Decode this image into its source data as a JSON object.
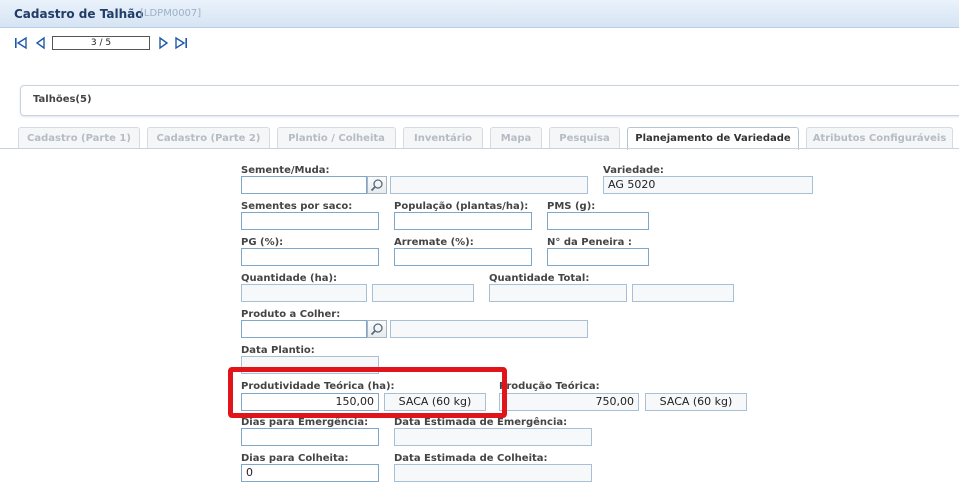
{
  "window": {
    "title": "Cadastro de Talhão",
    "code": "[LDPM0007]"
  },
  "nav": {
    "pager": "3 / 5"
  },
  "group": {
    "title": "Talhões(5)"
  },
  "tabs": [
    {
      "label": "Cadastro (Parte 1)"
    },
    {
      "label": "Cadastro (Parte 2)"
    },
    {
      "label": "Plantio / Colheita"
    },
    {
      "label": "Inventário"
    },
    {
      "label": "Mapa"
    },
    {
      "label": "Pesquisa"
    },
    {
      "label": "Planejamento de Variedade"
    },
    {
      "label": "Atributos Configuráveis"
    }
  ],
  "form": {
    "semente_label": "Semente/Muda:",
    "semente_value": "",
    "semente_desc": "",
    "variedade_label": "Variedade:",
    "variedade_value": "AG 5020",
    "sementes_saco_label": "Sementes por saco:",
    "sementes_saco_value": "",
    "populacao_label": "População (plantas/ha):",
    "populacao_value": "",
    "pms_label": "PMS (g):",
    "pms_value": "",
    "pg_label": "PG (%):",
    "pg_value": "",
    "arremate_label": "Arremate (%):",
    "arremate_value": "",
    "peneira_label": "N° da Peneira :",
    "peneira_value": "",
    "quantidade_label": "Quantidade (ha):",
    "quantidade_value": "",
    "quantidade_unit": "",
    "quantidade_total_label": "Quantidade Total:",
    "quantidade_total_value": "",
    "quantidade_total_unit": "",
    "produto_label": "Produto a Colher:",
    "produto_value": "",
    "produto_desc": "",
    "data_plantio_label": "Data Plantio:",
    "data_plantio_value": "",
    "produtividade_label": "Produtividade Teórica (ha):",
    "produtividade_value": "150,00",
    "produtividade_unit": "SACA (60 kg)",
    "producao_label": "Produção Teórica:",
    "producao_value": "750,00",
    "producao_unit": "SACA (60 kg)",
    "dias_emergencia_label": "Dias para Emergência:",
    "dias_emergencia_value": "",
    "data_emergencia_label": "Data Estimada de Emergência:",
    "data_emergencia_value": "",
    "dias_colheita_label": "Dias para Colheita:",
    "dias_colheita_value": "0",
    "data_colheita_label": "Data Estimada de Colheita:",
    "data_colheita_value": ""
  }
}
